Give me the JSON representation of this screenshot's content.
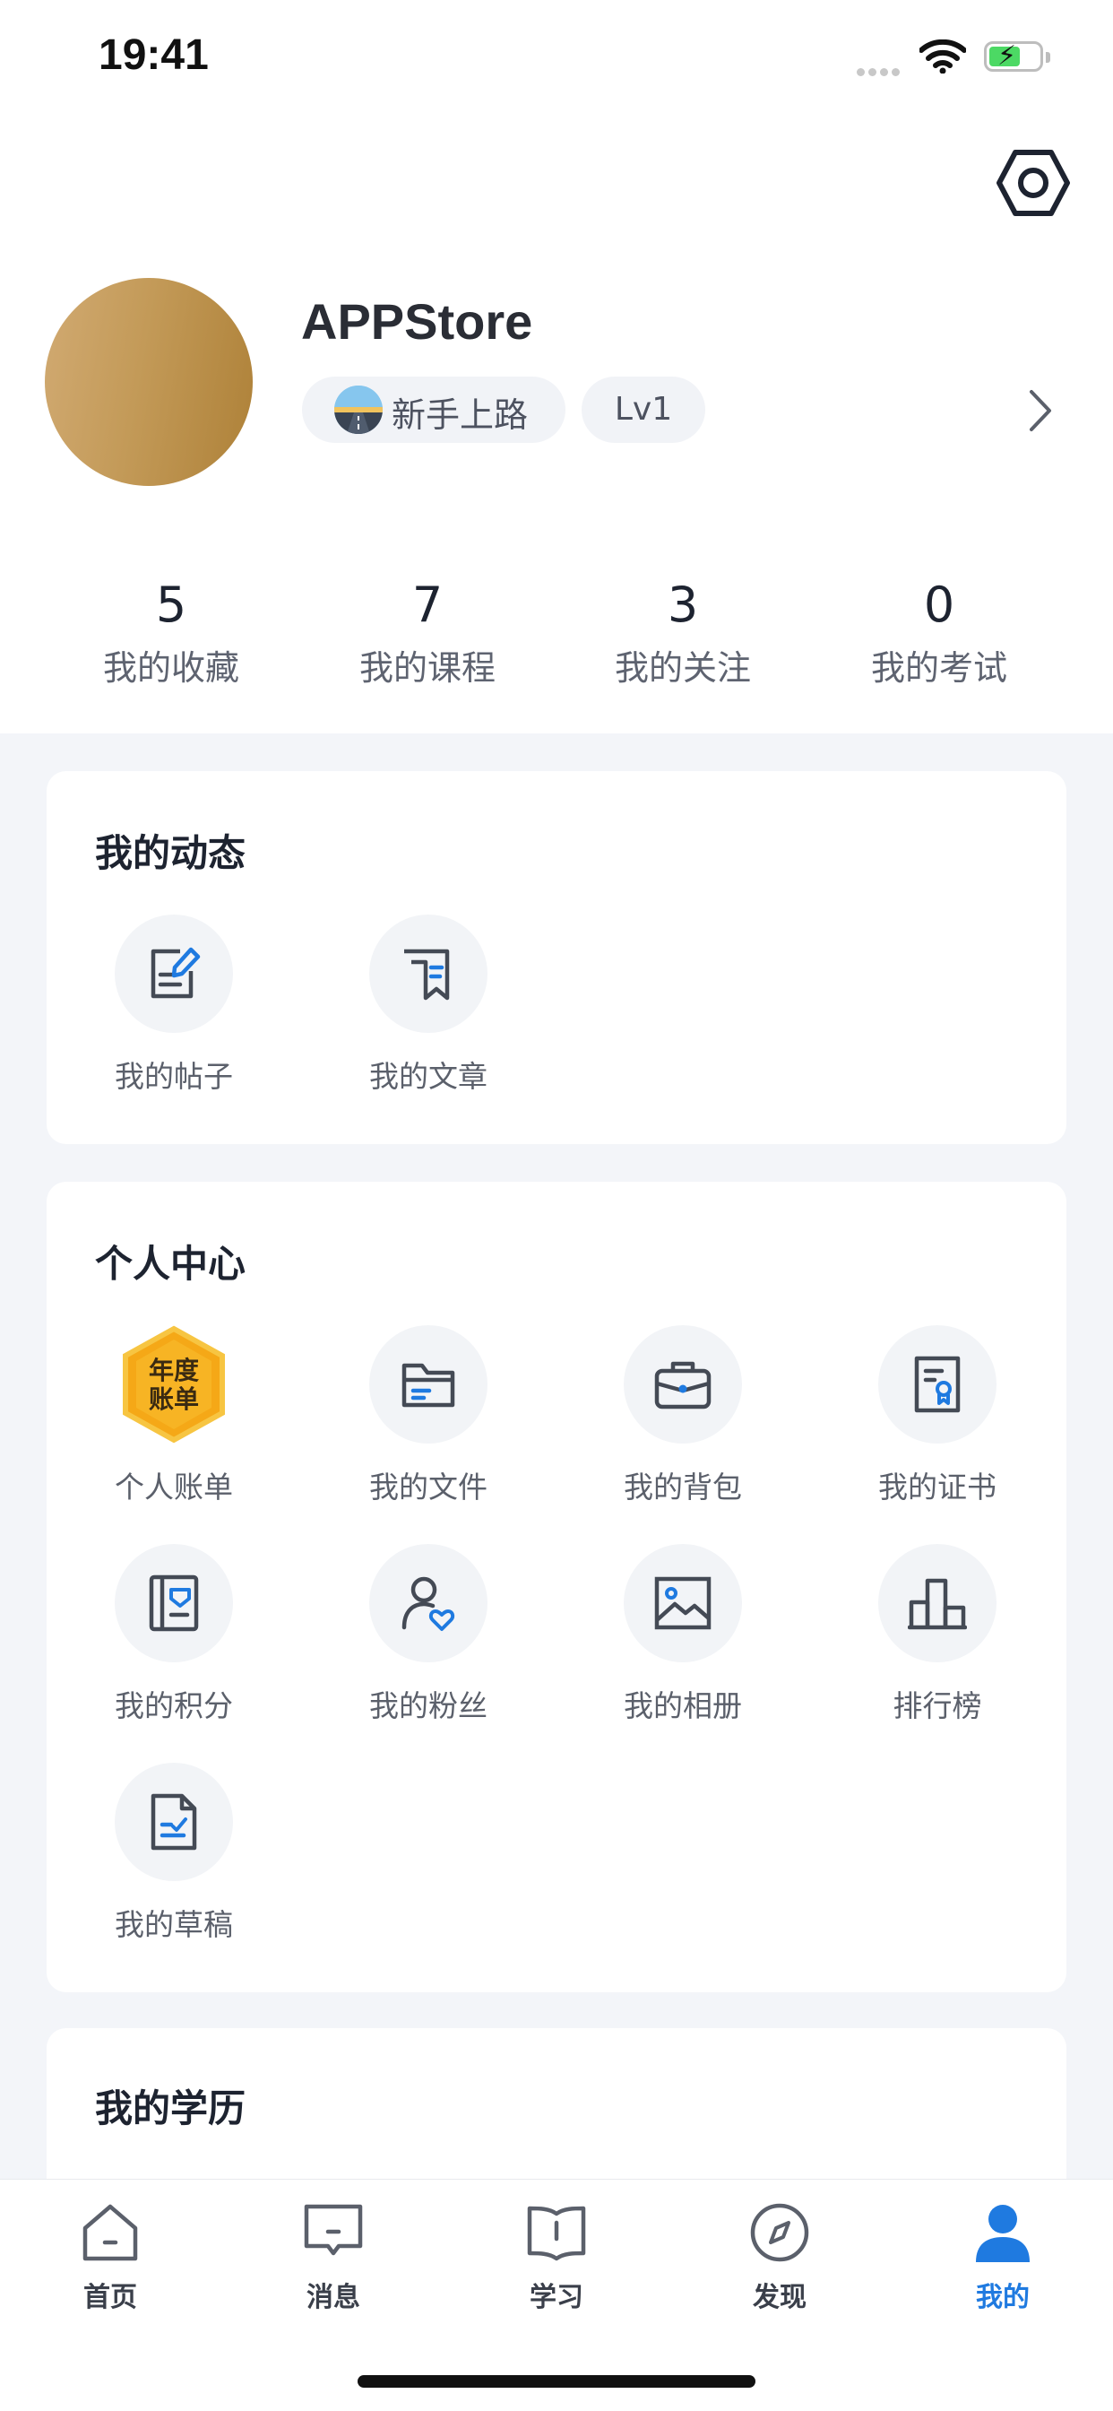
{
  "status_bar": {
    "time": "19:41"
  },
  "profile": {
    "username": "APPStore",
    "badge_title": "新手上路",
    "level": "Lv1"
  },
  "stats": [
    {
      "value": "5",
      "label": "我的收藏"
    },
    {
      "value": "7",
      "label": "我的课程"
    },
    {
      "value": "3",
      "label": "我的关注"
    },
    {
      "value": "0",
      "label": "我的考试"
    }
  ],
  "dynamics": {
    "title": "我的动态",
    "items": [
      {
        "label": "我的帖子",
        "icon": "edit-post-icon"
      },
      {
        "label": "我的文章",
        "icon": "article-icon"
      }
    ]
  },
  "personal_center": {
    "title": "个人中心",
    "annual_bill_badge_text": "年度账单",
    "items": [
      {
        "label": "个人账单",
        "icon": "annual-bill-icon"
      },
      {
        "label": "我的文件",
        "icon": "folder-icon"
      },
      {
        "label": "我的背包",
        "icon": "backpack-icon"
      },
      {
        "label": "我的证书",
        "icon": "certificate-icon"
      },
      {
        "label": "我的积分",
        "icon": "points-icon"
      },
      {
        "label": "我的粉丝",
        "icon": "fans-icon"
      },
      {
        "label": "我的相册",
        "icon": "album-icon"
      },
      {
        "label": "排行榜",
        "icon": "ranking-icon"
      },
      {
        "label": "我的草稿",
        "icon": "draft-icon"
      }
    ]
  },
  "education": {
    "title": "我的学历"
  },
  "tabbar": {
    "tabs": [
      {
        "label": "首页",
        "icon": "home-icon"
      },
      {
        "label": "消息",
        "icon": "message-icon"
      },
      {
        "label": "学习",
        "icon": "book-icon"
      },
      {
        "label": "发现",
        "icon": "compass-icon"
      },
      {
        "label": "我的",
        "icon": "user-icon"
      }
    ],
    "active": "我的"
  },
  "colors": {
    "accent": "#1f7ae0",
    "icon_stroke": "#444a55",
    "background": "#f3f5f9",
    "bill_badge": "#f5a817"
  }
}
